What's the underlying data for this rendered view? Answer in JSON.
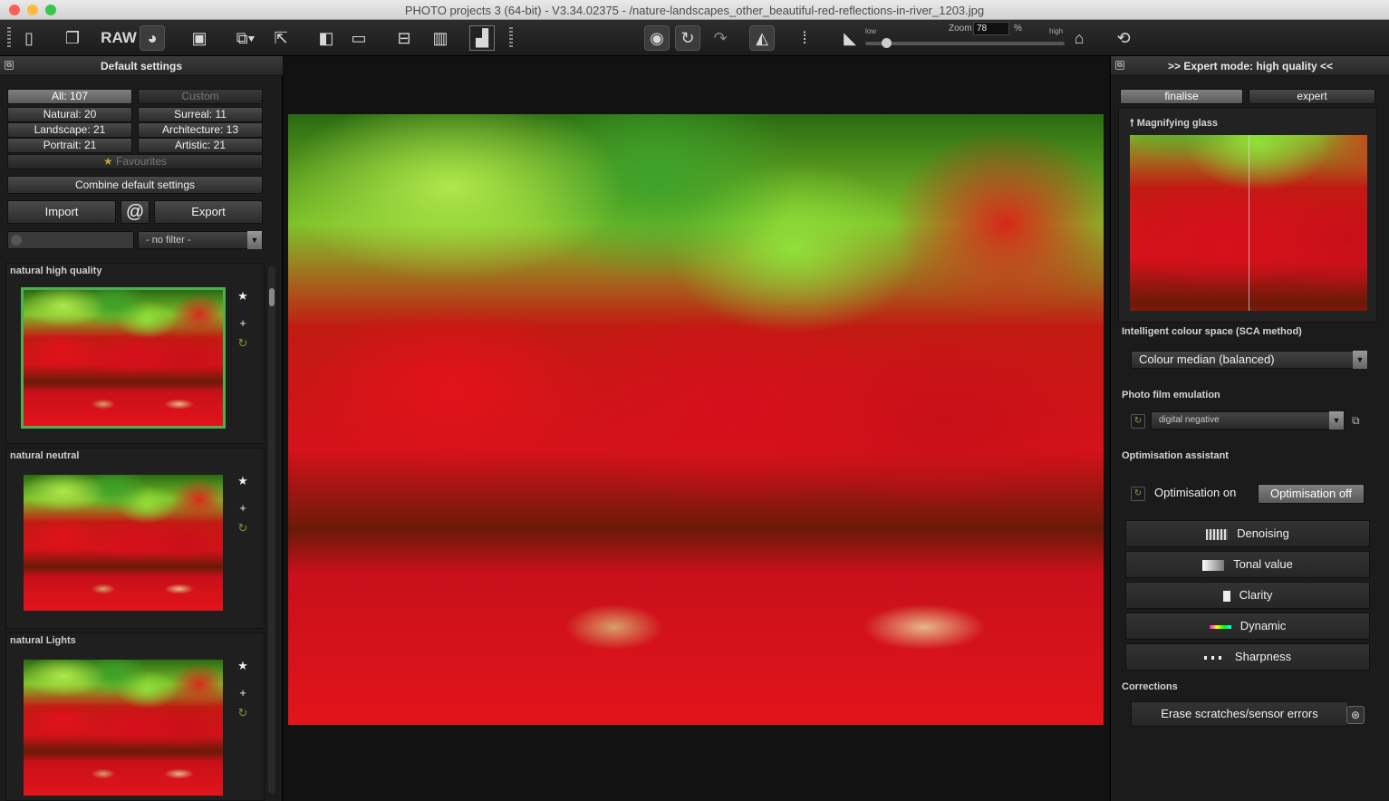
{
  "window": {
    "title": "PHOTO projects 3 (64-bit) - V3.34.02375 - /nature-landscapes_other_beautiful-red-reflections-in-river_1203.jpg"
  },
  "toolbar": {
    "raw_label": "RAW",
    "zoom_label": "Zoom",
    "zoom_value": "78",
    "zoom_unit": "%",
    "low_label": "low",
    "high_label": "high",
    "quality_level": 0.0
  },
  "left": {
    "header": "Default settings",
    "categories": [
      {
        "label": "All: 107",
        "active": true
      },
      {
        "label": "Custom",
        "active": false
      },
      {
        "label": "Natural: 20"
      },
      {
        "label": "Surreal: 11"
      },
      {
        "label": "Landscape: 21"
      },
      {
        "label": "Architecture: 13"
      },
      {
        "label": "Portrait: 21"
      },
      {
        "label": "Artistic: 21"
      }
    ],
    "favourites": "Favourites",
    "combine": "Combine default settings",
    "import": "Import",
    "export": "Export",
    "at_symbol": "@",
    "filter_value": "- no filter -",
    "presets": [
      {
        "label": "natural high quality",
        "selected": true
      },
      {
        "label": "natural neutral",
        "selected": false
      },
      {
        "label": "natural Lights",
        "selected": false
      }
    ]
  },
  "right": {
    "header": ">> Expert mode: high quality <<",
    "tab_finalise": "finalise",
    "tab_expert": "expert",
    "magnifier_label": "Magnifying glass",
    "colour_space_label": "Intelligent colour space (SCA method)",
    "colour_space_value": "Colour median (balanced)",
    "film_label": "Photo film emulation",
    "film_value": "digital negative",
    "opt_label": "Optimisation assistant",
    "opt_on": "Optimisation on",
    "opt_off": "Optimisation off",
    "opt_items": [
      "Denoising",
      "Tonal value",
      "Clarity",
      "Dynamic",
      "Sharpness"
    ],
    "corrections_label": "Corrections",
    "erase_label": "Erase scratches/sensor errors"
  },
  "colors": {
    "accent_green": "#4caf50",
    "panel_bg": "#1c1c1c"
  }
}
